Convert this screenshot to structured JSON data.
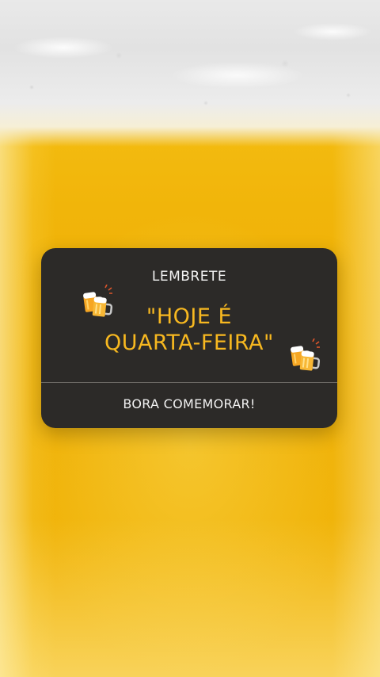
{
  "background": {
    "subject": "beer-glass-photo",
    "colors": {
      "beer": "#f1b50a",
      "foam": "#e6e6e6"
    }
  },
  "reminder": {
    "label": "LEMBRETE",
    "title_line1": "\"HOJE É",
    "title_line2": "QUARTA-FEIRA\"",
    "action": "BORA COMEMORAR!",
    "icons": [
      "clinking-beer-mugs-icon",
      "clinking-beer-mugs-icon"
    ],
    "colors": {
      "card": "#2c2a28",
      "title": "#f7b820",
      "text": "#f2f2f2"
    }
  }
}
